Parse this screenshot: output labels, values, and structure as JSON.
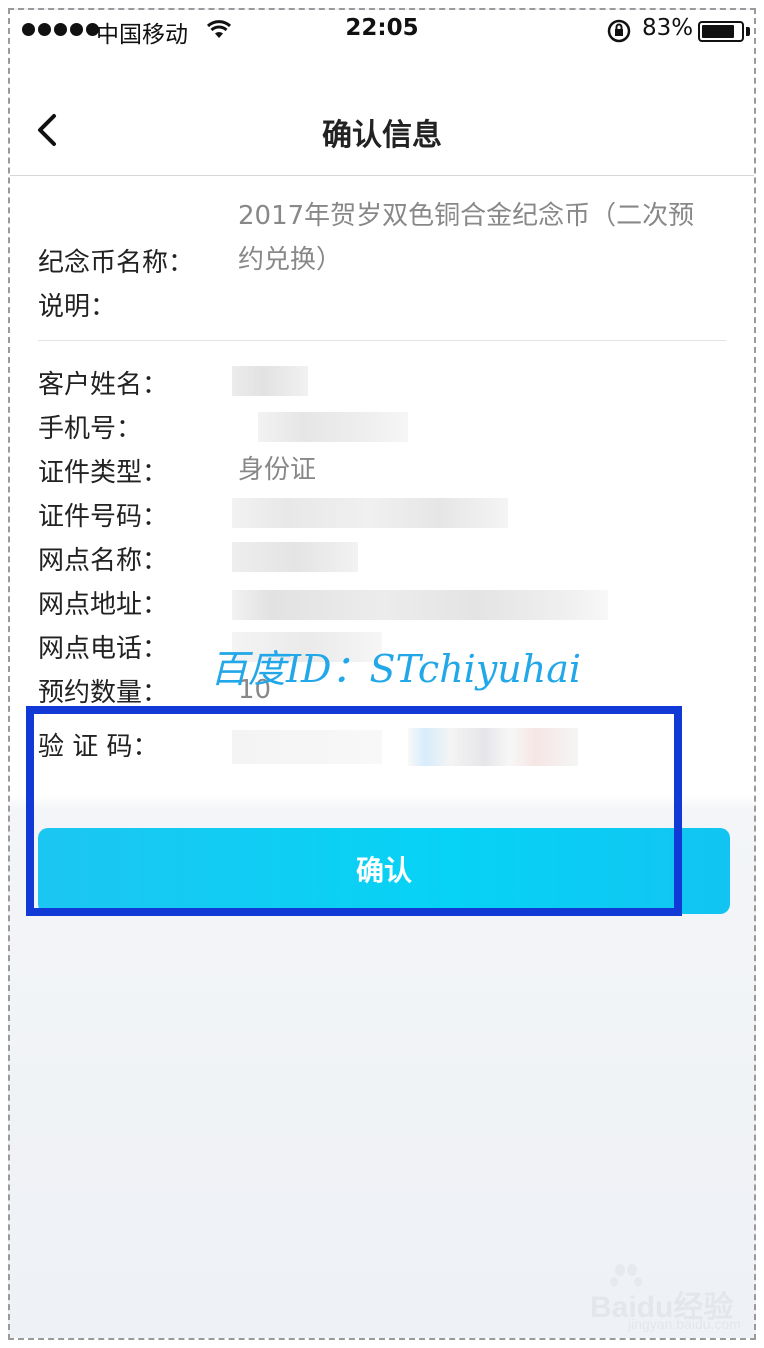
{
  "status_bar": {
    "carrier": "中国移动",
    "time": "22:05",
    "battery": "83%",
    "battery_level": 0.83
  },
  "nav": {
    "title": "确认信息"
  },
  "coin": {
    "label_name": "纪念币名称：",
    "label_desc": "说明：",
    "name_value": "2017年贺岁双色铜合金纪念币（二次预约兑换）"
  },
  "fields": [
    {
      "label": "客户姓名：",
      "value": ""
    },
    {
      "label": "手机号：",
      "value": ""
    },
    {
      "label": "证件类型：",
      "value": "身份证"
    },
    {
      "label": "证件号码：",
      "value": ""
    },
    {
      "label": "网点名称：",
      "value": ""
    },
    {
      "label": "网点地址：",
      "value": ""
    },
    {
      "label": "网点电话：",
      "value": ""
    },
    {
      "label": "预约数量：",
      "value": "10"
    }
  ],
  "captcha": {
    "label": "验 证 码："
  },
  "watermark": "百度ID：STchiyuhai",
  "confirm_button": "确认",
  "baidu_logo": {
    "text": "Baidu经验",
    "url": "jingyan.baidu.com"
  },
  "colors": {
    "accent": "#06d3f5",
    "highlight_box": "#1039d6",
    "watermark": "#22a7e8"
  }
}
